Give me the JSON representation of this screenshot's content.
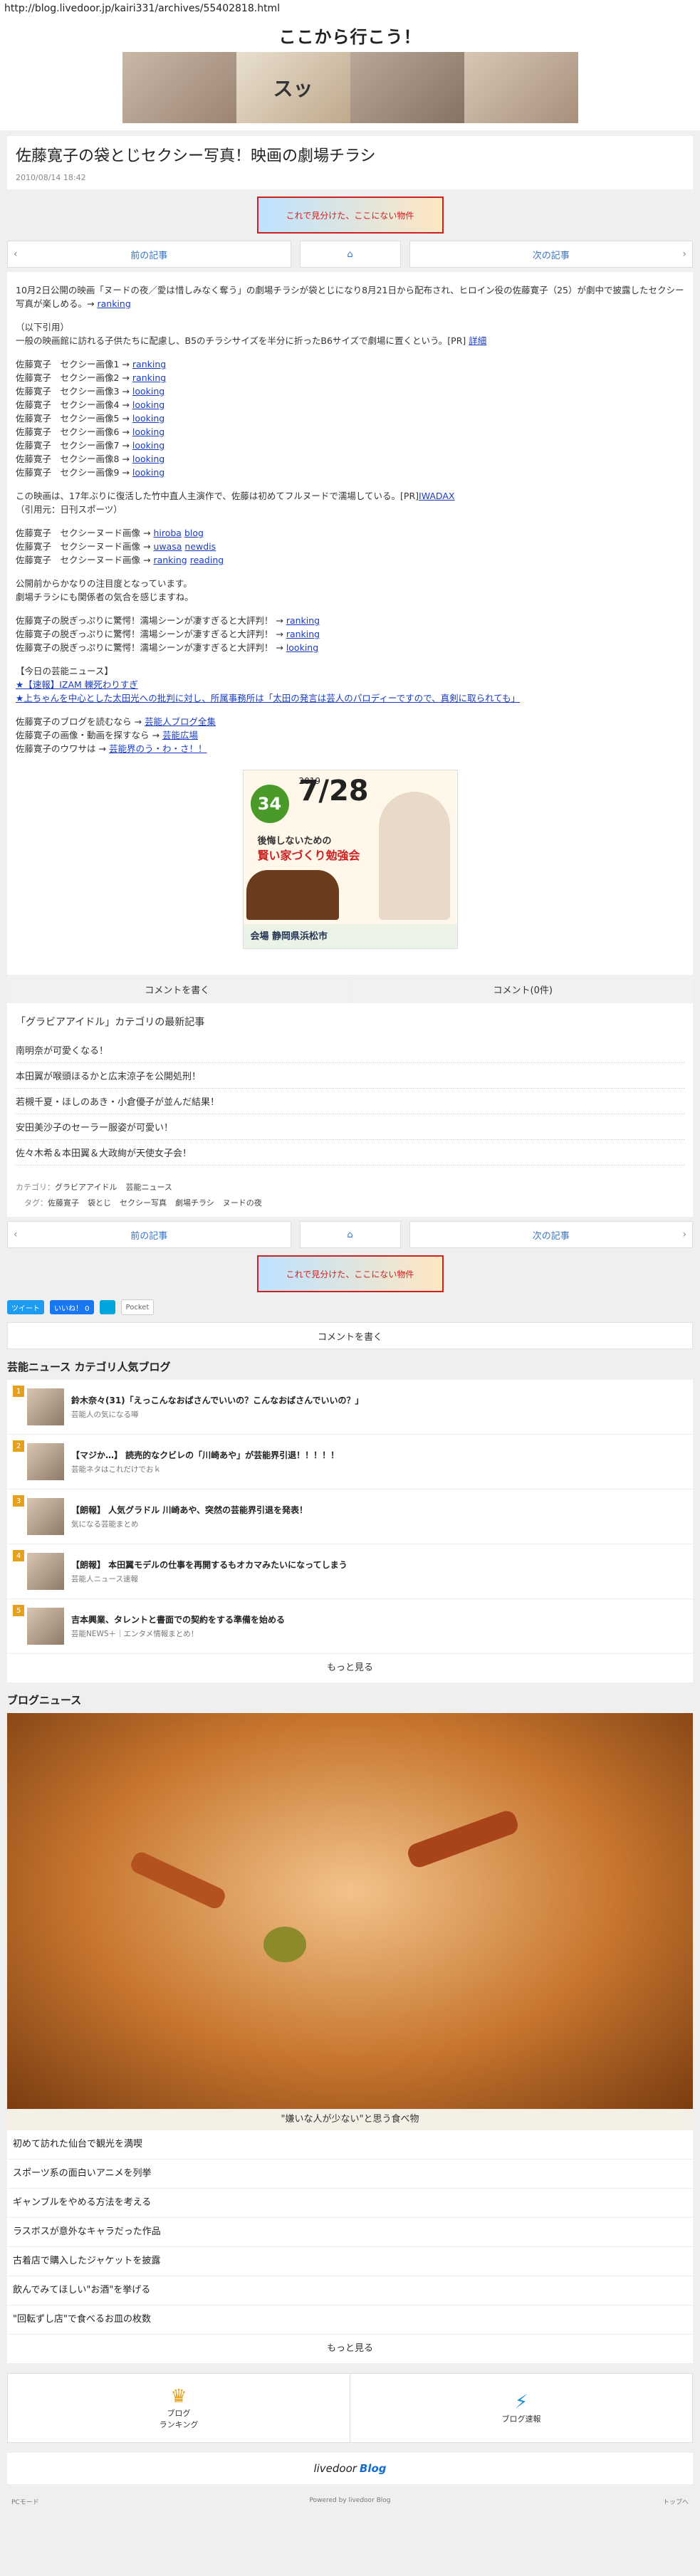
{
  "url": "http://blog.livedoor.jp/kairi331/archives/55402818.html",
  "site": {
    "title": "ここから行こう！",
    "banner_text": "スッ"
  },
  "article": {
    "title": "佐藤寛子の袋とじセクシー写真！映画の劇場チラシ",
    "date": "2010/08/14 18:42"
  },
  "ad_small_text": "これで見分けた、ここにない物件",
  "nav": {
    "prev": "前の記事",
    "next": "次の記事"
  },
  "body": {
    "intro": "10月2日公開の映画「ヌードの夜／愛は惜しみなく奪う」の劇場チラシが袋とじになり8月21日から配布され、ヒロイン役の佐藤寛子（25）が劇中で披露したセクシー写真が楽しめる。→",
    "intro_link": "ranking",
    "quote_head": "（以下引用）",
    "quote_body": "一般の映画館に訪れる子供たちに配慮し、B5のチラシサイズを半分に折ったB6サイズで劇場に置くという。[PR]",
    "quote_link": "詳細",
    "images": [
      {
        "label": "佐藤寛子　セクシー画像1 →",
        "link": "ranking"
      },
      {
        "label": "佐藤寛子　セクシー画像2 →",
        "link": "ranking"
      },
      {
        "label": "佐藤寛子　セクシー画像3 →",
        "link": "looking"
      },
      {
        "label": "佐藤寛子　セクシー画像4 →",
        "link": "looking"
      },
      {
        "label": "佐藤寛子　セクシー画像5 →",
        "link": "looking"
      },
      {
        "label": "佐藤寛子　セクシー画像6 →",
        "link": "looking"
      },
      {
        "label": "佐藤寛子　セクシー画像7 →",
        "link": "looking"
      },
      {
        "label": "佐藤寛子　セクシー画像8 →",
        "link": "looking"
      },
      {
        "label": "佐藤寛子　セクシー画像9 →",
        "link": "looking"
      }
    ],
    "movie_text": "この映画は、17年ぶりに復活した竹中直人主演作で、佐藤は初めてフルヌードで濡場している。[PR]",
    "movie_link": "IWADAX",
    "movie_source": "（引用元：日刊スポーツ）",
    "nude": [
      {
        "label": "佐藤寛子　セクシーヌード画像 →",
        "l1": "hiroba",
        "l2": "blog"
      },
      {
        "label": "佐藤寛子　セクシーヌード画像 →",
        "l1": "uwasa",
        "l2": "newdis"
      },
      {
        "label": "佐藤寛子　セクシーヌード画像 →",
        "l1": "ranking",
        "l2": "reading"
      }
    ],
    "notice1": "公開前からかなりの注目度となっています。",
    "notice2": "劇場チラシにも関係者の気合を感じますね。",
    "scenes": [
      {
        "label": "佐藤寛子の脱ぎっぷりに驚愕！濡場シーンが凄すぎると大評判！ →",
        "link": "ranking"
      },
      {
        "label": "佐藤寛子の脱ぎっぷりに驚愕！濡場シーンが凄すぎると大評判！ →",
        "link": "ranking"
      },
      {
        "label": "佐藤寛子の脱ぎっぷりに驚愕！濡場シーンが凄すぎると大評判！ →",
        "link": "looking"
      }
    ],
    "today_head": "【今日の芸能ニュース】",
    "today1": "★【速報】IZAM 轢死わりすぎ",
    "today2": "★上ちゃんを中心とした太田光への批判に対し、所属事務所は「太田の発言は芸人のパロディーですので、真剣に取られても」",
    "foot1_label": "佐藤寛子のブログを読むなら →",
    "foot1_link": "芸能人ブログ全集",
    "foot2_label": "佐藤寛子の画像・動画を探すなら →",
    "foot2_link": "芸能広場",
    "foot3_label": "佐藤寛子のウワサは →",
    "foot3_link": "芸能界のう・わ・さ！！"
  },
  "ad_big": {
    "badge": "34",
    "year": "2019",
    "date": "7/28",
    "line1": "後悔しないための",
    "line2": "賢い家づくり勉強会",
    "venue": "会場 静岡県浜松市"
  },
  "buttons": {
    "comment_write": "コメントを書く",
    "comment_count": "コメント(0件)"
  },
  "latest": {
    "heading": "「グラビアアイドル」カテゴリの最新記事",
    "items": [
      "南明奈が可愛くなる！",
      "本田翼が喉頭ほるかと広末涼子を公開処刑！",
      "若槻千夏・ほしのあき・小倉優子が並んだ結果！",
      "安田美沙子のセーラー服姿が可愛い！",
      "佐々木希＆本田翼＆大政絢が天使女子会！"
    ]
  },
  "meta": {
    "category_label": "カテゴリ：",
    "categories": [
      "グラビアアイドル",
      "芸能ニュース"
    ],
    "tag_label": "タグ：",
    "tags": [
      "佐藤寛子",
      "袋とじ",
      "セクシー写真",
      "劇場チラシ",
      "ヌードの夜"
    ]
  },
  "social": {
    "tweet": "ツイート",
    "like": "いいね！ 0",
    "pocket": "Pocket"
  },
  "comment_bar": "コメントを書く",
  "ranking": {
    "title": "芸能ニュース カテゴリ人気ブログ",
    "items": [
      {
        "rank": "1",
        "title": "鈴木奈々(31)「えっこんなおばさんでいいの？こんなおばさんでいいの？」",
        "source": "芸能人の気になる噂"
      },
      {
        "rank": "2",
        "title": "【マジか…】 読売的なクビレの「川崎あや」が芸能界引退！！！！！",
        "source": "芸能ネタはこれだけでおｋ"
      },
      {
        "rank": "3",
        "title": "【朗報】 人気グラドル 川崎あや、突然の芸能界引退を発表！",
        "source": "気になる芸能まとめ"
      },
      {
        "rank": "4",
        "title": "【朗報】 本田翼モデルの仕事を再開するもオカマみたいになってしまう",
        "source": "芸能人ニュース速報"
      },
      {
        "rank": "5",
        "title": "吉本興業、タレントと書面での契約をする準備を始める",
        "source": "芸能NEWS＋｜エンタメ情報まとめ！"
      }
    ],
    "more": "もっと見る"
  },
  "news": {
    "title": "ブログニュース",
    "caption": "\"嫌いな人が少ない\"と思う食べ物",
    "items": [
      "初めて訪れた仙台で観光を満喫",
      "スポーツ系の面白いアニメを列挙",
      "ギャンブルをやめる方法を考える",
      "ラスボスが意外なキャラだった作品",
      "古着店で購入したジャケットを披露",
      "飲んでみてほしい\"お酒\"を挙げる",
      "\"回転ずし店\"で食べるお皿の枚数"
    ],
    "more": "もっと見る"
  },
  "footer": {
    "ranking_label_1": "ブログ",
    "ranking_label_2": "ランキング",
    "speed_label": "ブログ速報",
    "logo_1": "livedoor",
    "logo_2": "Blog",
    "powered": "Powered by livedoor Blog",
    "pc": "PCモード",
    "top": "トップへ"
  }
}
